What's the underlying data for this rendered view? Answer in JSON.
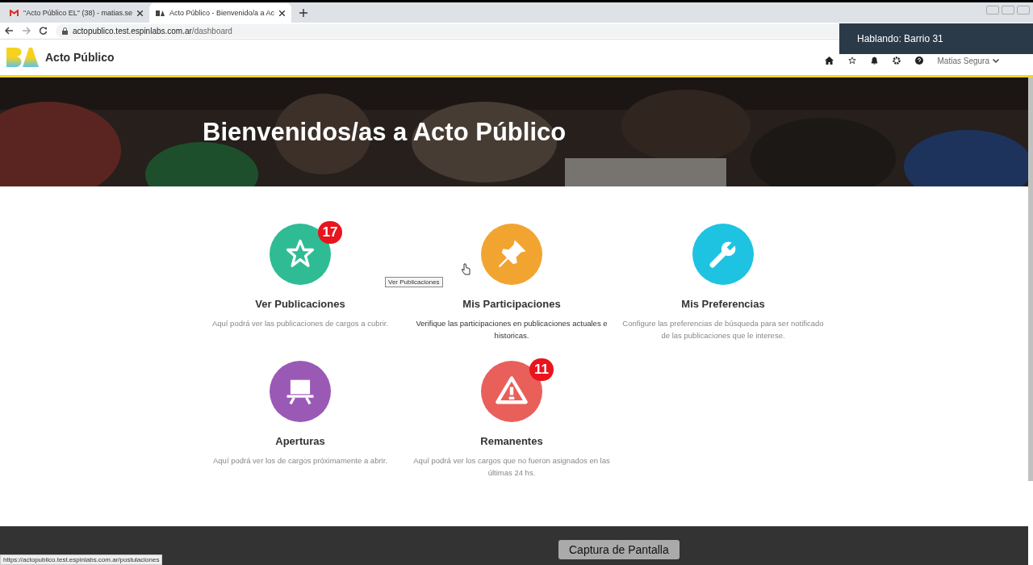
{
  "browser": {
    "tabs": [
      {
        "title": "\"Acto Público EL\" (38) - matias.se",
        "selected": false,
        "kind": "mail"
      },
      {
        "title": "Acto Público - Bienvenido/a a Ac",
        "selected": true,
        "kind": "site"
      }
    ],
    "url_host": "actopublico.test.espinlabs.com.ar",
    "url_path": "/dashboard"
  },
  "header": {
    "brand": "Acto Público",
    "user": "Matias Segura"
  },
  "hero": {
    "kind": "picture",
    "title": "Bienvenidos/as a Acto Público"
  },
  "cards": [
    {
      "kind": "star",
      "color": "#2fbc94",
      "badge": "17",
      "title": "Ver Publicaciones",
      "text": "Aquí podrá ver las publicaciones de cargos a cubrir.",
      "muted": true
    },
    {
      "kind": "pin",
      "color": "#f2a431",
      "title": "Mis Participaciones",
      "text": "Verifique las participaciones en publicaciones actuales e historicas.",
      "muted": false
    },
    {
      "kind": "wrench",
      "color": "#1ec3e2",
      "title": "Mis Preferencias",
      "text": "Configure las preferencias de búsqueda para ser notificado de las publicaciones que le interese.",
      "muted": true
    },
    {
      "kind": "easel",
      "color": "#9b59b6",
      "title": "Aperturas",
      "text": "Aquí podrá ver los de cargos próximamente a abrir.",
      "muted": true
    },
    {
      "kind": "warning",
      "color": "#e95f5a",
      "badge": "11",
      "title": "Remanentes",
      "text": "Aquí podrá ver los cargos que no fueron asignados en las últimas 24 hs.",
      "muted": true
    }
  ],
  "hover_tooltip": "Ver Publicaciones",
  "status_url": "https://actopublico.test.espinlabs.com.ar/postulaciones",
  "speaking_banner": "Hablando: Barrio 31",
  "capture_tooltip": "Captura de Pantalla"
}
